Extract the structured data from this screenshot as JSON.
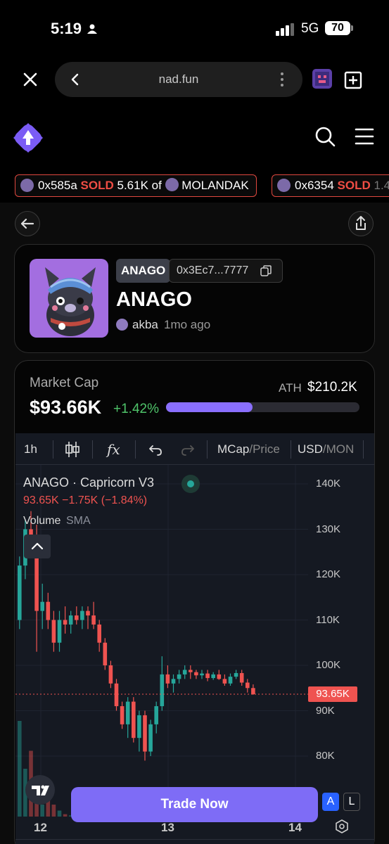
{
  "status_bar": {
    "time": "5:19",
    "network": "5G",
    "battery": "70"
  },
  "browser": {
    "url": "nad.fun"
  },
  "ticker": [
    {
      "address": "0x585a",
      "action": "SOLD",
      "amount": "5.61K of",
      "token": "MOLANDAK"
    },
    {
      "address": "0x6354",
      "action": "SOLD",
      "amount": "1.4",
      "token": ""
    }
  ],
  "token": {
    "ticker": "ANAGO",
    "address": "0x3Ec7...7777",
    "name": "ANAGO",
    "creator": "akba",
    "age": "1mo ago"
  },
  "market": {
    "label": "Market Cap",
    "value": "$93.66K",
    "change": "+1.42%",
    "ath_label": "ATH",
    "ath_value": "$210.2K",
    "ath_progress": 0.446
  },
  "chart_toolbar": {
    "interval": "1h",
    "fx": "fx",
    "mcap": "MCap",
    "price": "Price",
    "usd": "USD",
    "mon": "MON"
  },
  "chart_legend": {
    "title": "ANAGO · Capricorn V3",
    "ohlc": "93.65K  −1.75K (−1.84%)",
    "volume": "Volume",
    "sma": "SMA",
    "current_label": "93.65K"
  },
  "chart_data": {
    "type": "candlestick",
    "title": "ANAGO · Capricorn V3",
    "y_ticks": [
      "140K",
      "130K",
      "120K",
      "110K",
      "100K",
      "90K",
      "80K"
    ],
    "x_ticks": [
      "12",
      "13",
      "14"
    ],
    "ylim": [
      76000,
      145000
    ],
    "current_price": 93650,
    "candles": [
      [
        110000,
        124000,
        108000,
        122000
      ],
      [
        122000,
        132000,
        119000,
        130000
      ],
      [
        130000,
        134000,
        125000,
        128000
      ],
      [
        128000,
        131000,
        103000,
        112000
      ],
      [
        112000,
        118000,
        108000,
        114000
      ],
      [
        114000,
        116000,
        108000,
        110000
      ],
      [
        110000,
        112000,
        103000,
        105000
      ],
      [
        105000,
        112000,
        103000,
        110000
      ],
      [
        110000,
        113000,
        107000,
        109000
      ],
      [
        109000,
        112000,
        107000,
        111000
      ],
      [
        111000,
        113000,
        109000,
        110000
      ],
      [
        110000,
        113000,
        108000,
        112000
      ],
      [
        112000,
        113000,
        108000,
        111000
      ],
      [
        111000,
        114000,
        108000,
        109000
      ],
      [
        109000,
        110000,
        103000,
        105000
      ],
      [
        105000,
        106000,
        99000,
        100000
      ],
      [
        100000,
        101000,
        95000,
        96000
      ],
      [
        96000,
        97000,
        90000,
        91000
      ],
      [
        91000,
        92000,
        86000,
        87000
      ],
      [
        87000,
        93000,
        84000,
        92000
      ],
      [
        92000,
        93000,
        83000,
        84000
      ],
      [
        84000,
        90000,
        81000,
        89000
      ],
      [
        89000,
        90000,
        79000,
        81000
      ],
      [
        81000,
        88000,
        80000,
        87000
      ],
      [
        87000,
        92000,
        85000,
        91000
      ],
      [
        91000,
        102000,
        90000,
        98000
      ],
      [
        98000,
        100000,
        95000,
        96000
      ],
      [
        96000,
        98000,
        94000,
        97000
      ],
      [
        97000,
        99000,
        96000,
        98000
      ],
      [
        98000,
        100000,
        97000,
        99000
      ],
      [
        99000,
        100000,
        97000,
        98500
      ],
      [
        98500,
        99000,
        97000,
        97800
      ],
      [
        97800,
        99000,
        97000,
        98200
      ],
      [
        98200,
        99000,
        96500,
        97200
      ],
      [
        97200,
        98500,
        96800,
        98000
      ],
      [
        98000,
        99000,
        96800,
        97000
      ],
      [
        97000,
        98000,
        95500,
        96000
      ],
      [
        96000,
        98200,
        95500,
        97500
      ],
      [
        97500,
        99000,
        97000,
        98300
      ],
      [
        98300,
        99000,
        95500,
        96200
      ],
      [
        96200,
        97000,
        94000,
        95000
      ],
      [
        95000,
        95800,
        93500,
        93650
      ]
    ],
    "volumes": [
      0.8,
      0.4,
      0.55,
      0.3,
      0.1,
      0.15,
      0.1,
      0.05,
      0.02,
      0.01,
      0.01,
      0.02,
      0.02,
      0.02,
      0.03,
      0.04,
      0.05,
      0.06,
      0.08,
      0.1,
      0.07,
      0.05,
      0.06,
      0.04,
      0.05,
      0.03,
      0.02,
      0.02,
      0.01,
      0.01,
      0.01,
      0.01,
      0.01,
      0.01,
      0.01,
      0.01,
      0.01,
      0.01,
      0.01,
      0.01,
      0.01,
      0.01
    ]
  },
  "actions": {
    "trade": "Trade Now",
    "auto": "A",
    "log": "L"
  },
  "colors": {
    "up": "#26a69a",
    "down": "#ef5350",
    "accent": "#7e6cf6"
  }
}
